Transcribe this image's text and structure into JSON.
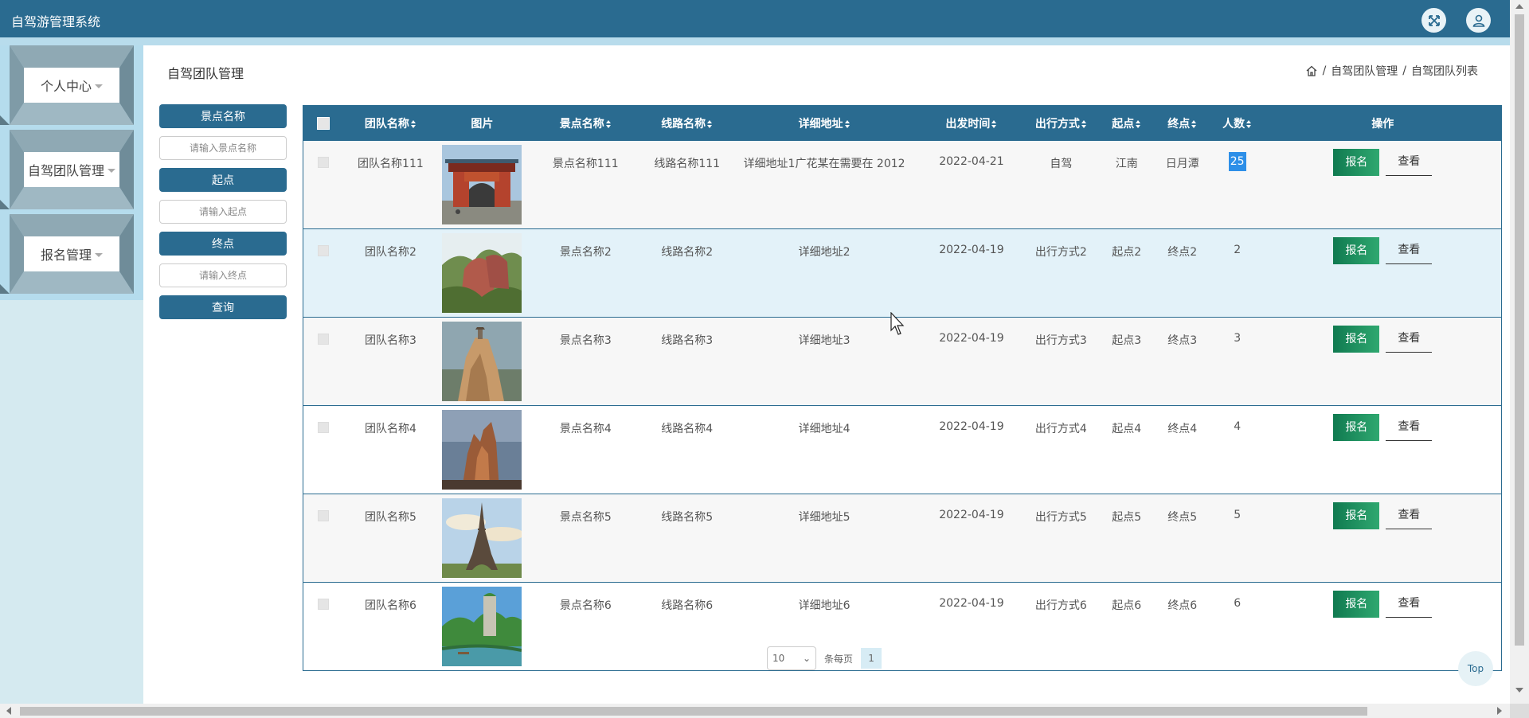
{
  "app": {
    "title": "自驾游管理系统"
  },
  "sidebar": {
    "items": [
      {
        "label": "个人中心"
      },
      {
        "label": "自驾团队管理"
      },
      {
        "label": "报名管理"
      }
    ]
  },
  "page": {
    "title": "自驾团队管理",
    "breadcrumb": [
      "自驾团队管理",
      "自驾团队列表"
    ]
  },
  "filter": {
    "scenic_label": "景点名称",
    "scenic_placeholder": "请输入景点名称",
    "start_label": "起点",
    "start_placeholder": "请输入起点",
    "end_label": "终点",
    "end_placeholder": "请输入终点",
    "search_label": "查询"
  },
  "table": {
    "headers": [
      "团队名称",
      "图片",
      "景点名称",
      "线路名称",
      "详细地址",
      "出发时间",
      "出行方式",
      "起点",
      "终点",
      "人数",
      "操作"
    ],
    "rows": [
      {
        "team": "团队名称111",
        "scenic": "景点名称111",
        "route": "线路名称111",
        "address": "详细地址1广花某在需要在 2012",
        "date": "2022-04-21",
        "mode": "自驾",
        "start": "江南",
        "end": "日月潭",
        "count": "25",
        "image": "gate-photo"
      },
      {
        "team": "团队名称2",
        "scenic": "景点名称2",
        "route": "线路名称2",
        "address": "详细地址2",
        "date": "2022-04-19",
        "mode": "出行方式2",
        "start": "起点2",
        "end": "终点2",
        "count": "2",
        "image": "red-cliff-photo"
      },
      {
        "team": "团队名称3",
        "scenic": "景点名称3",
        "route": "线路名称3",
        "address": "详细地址3",
        "date": "2022-04-19",
        "mode": "出行方式3",
        "start": "起点3",
        "end": "终点3",
        "count": "3",
        "image": "cliff-pagoda-photo"
      },
      {
        "team": "团队名称4",
        "scenic": "景点名称4",
        "route": "线路名称4",
        "address": "详细地址4",
        "date": "2022-04-19",
        "mode": "出行方式4",
        "start": "起点4",
        "end": "终点4",
        "count": "4",
        "image": "rock-pillar-photo"
      },
      {
        "team": "团队名称5",
        "scenic": "景点名称5",
        "route": "线路名称5",
        "address": "详细地址5",
        "date": "2022-04-19",
        "mode": "出行方式5",
        "start": "起点5",
        "end": "终点5",
        "count": "5",
        "image": "eiffel-tower-photo"
      },
      {
        "team": "团队名称6",
        "scenic": "景点名称6",
        "route": "线路名称6",
        "address": "详细地址6",
        "date": "2022-04-19",
        "mode": "出行方式6",
        "start": "起点6",
        "end": "终点6",
        "count": "6",
        "image": "river-mountain-photo"
      }
    ],
    "sign_label": "报名",
    "view_label": "查看"
  },
  "pager": {
    "page_size": "10",
    "per_page_label": "条每页",
    "current_page": "1"
  },
  "top_button": {
    "label": "Top"
  },
  "colors": {
    "primary": "#2a6b90",
    "sidebar": "#b5dced",
    "sign_button": "#1a8a5c",
    "highlight": "#2d8fe8"
  }
}
